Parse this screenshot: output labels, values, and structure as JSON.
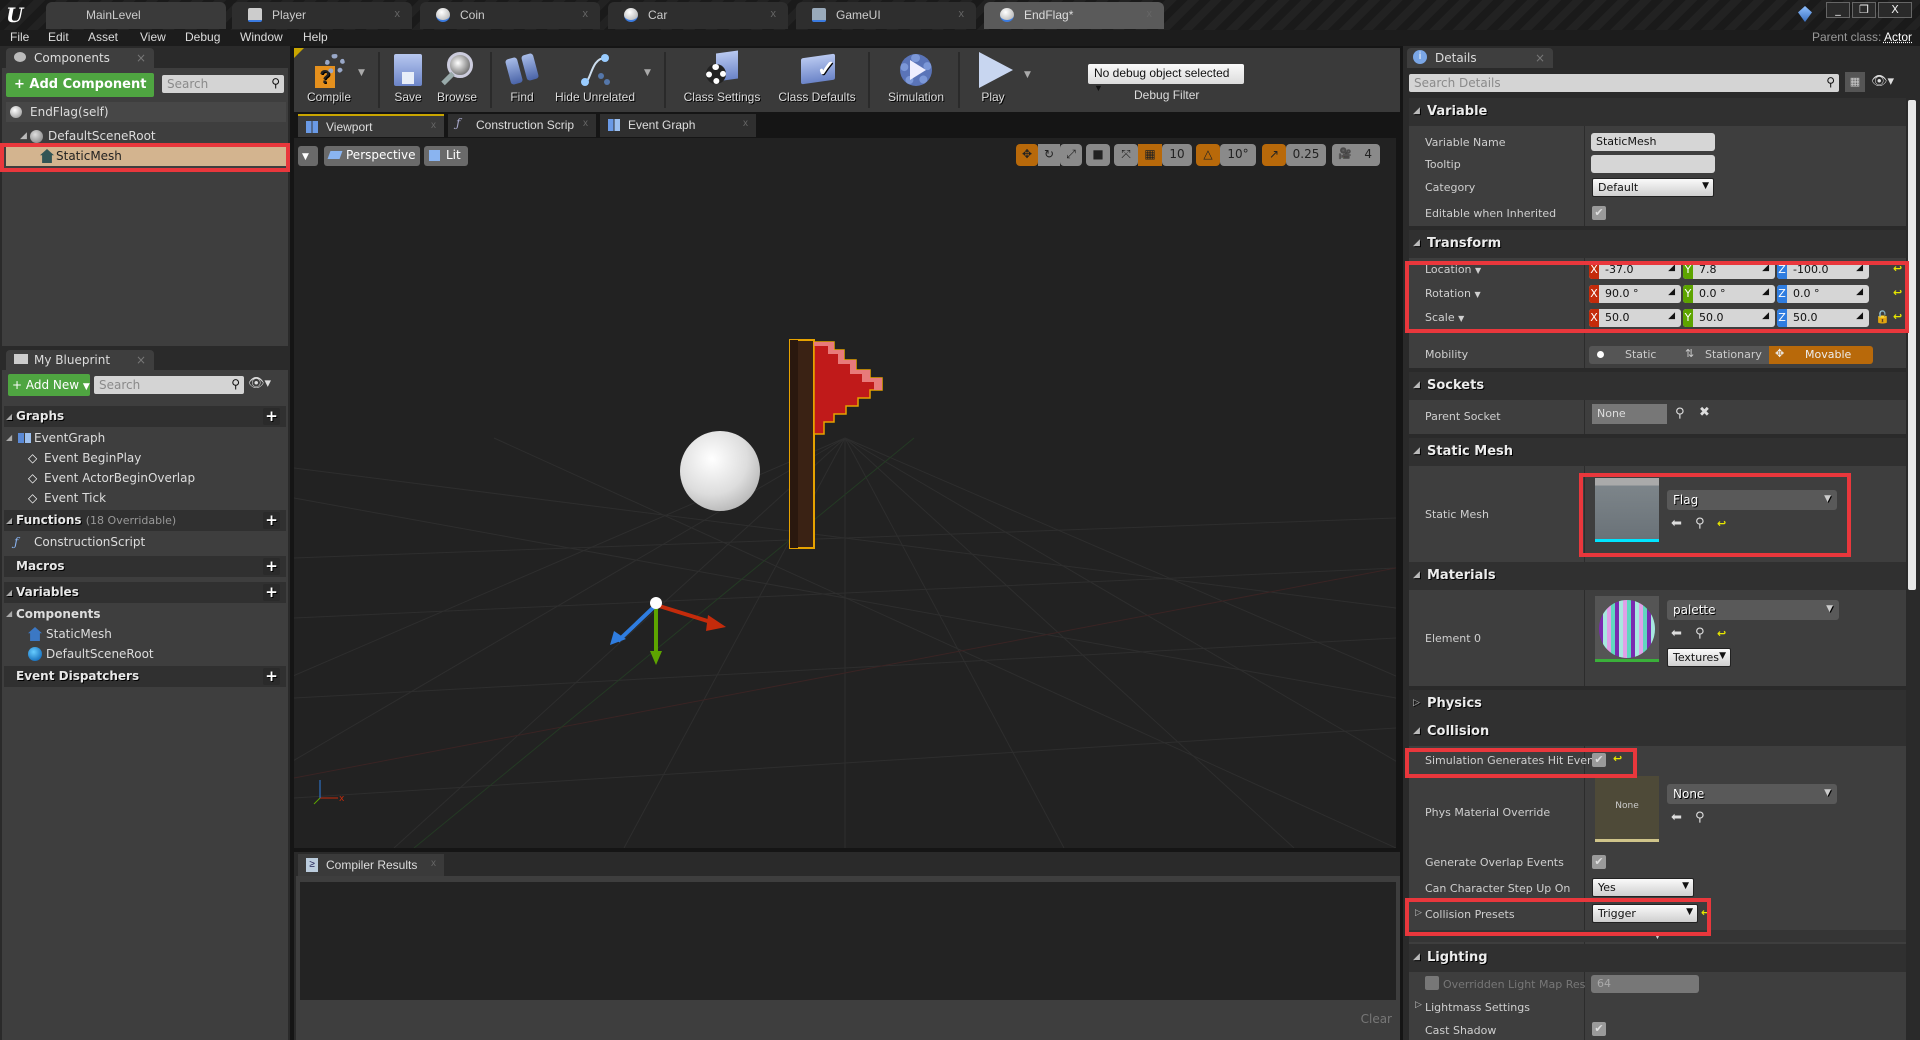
{
  "titlebar": {
    "tabs": [
      {
        "label": "MainLevel",
        "icon": "level-icon"
      },
      {
        "label": "Player",
        "icon": "character-blueprint-icon"
      },
      {
        "label": "Coin",
        "icon": "actor-blueprint-icon"
      },
      {
        "label": "Car",
        "icon": "actor-blueprint-icon"
      },
      {
        "label": "GameUI",
        "icon": "widget-blueprint-icon"
      },
      {
        "label": "EndFlag*",
        "icon": "actor-blueprint-icon",
        "active": true
      }
    ],
    "window_buttons": {
      "minimize": "_",
      "restore": "❐",
      "close": "X"
    }
  },
  "menubar": {
    "items": [
      "File",
      "Edit",
      "Asset",
      "View",
      "Debug",
      "Window",
      "Help"
    ],
    "parent_class_label": "Parent class:",
    "parent_class_value": "Actor"
  },
  "components": {
    "tab_label": "Components",
    "add_button": "+ Add Component",
    "search_placeholder": "Search",
    "self_item": "EndFlag(self)",
    "tree": [
      {
        "label": "DefaultSceneRoot",
        "icon": "scene-root-icon"
      },
      {
        "label": "StaticMesh",
        "icon": "static-mesh-icon",
        "selected": true
      }
    ]
  },
  "my_blueprint": {
    "tab_label": "My Blueprint",
    "add_button": "+ Add New",
    "search_placeholder": "Search",
    "graphs_label": "Graphs",
    "event_graph_label": "EventGraph",
    "events": [
      "Event BeginPlay",
      "Event ActorBeginOverlap",
      "Event Tick"
    ],
    "functions_label": "Functions",
    "functions_overridable": "(18 Overridable)",
    "functions": [
      "ConstructionScript"
    ],
    "macros_label": "Macros",
    "variables_label": "Variables",
    "components_label": "Components",
    "component_vars": [
      "StaticMesh",
      "DefaultSceneRoot"
    ],
    "event_dispatchers_label": "Event Dispatchers"
  },
  "toolbar": {
    "compile": "Compile",
    "save": "Save",
    "browse": "Browse",
    "find": "Find",
    "hide_unrelated": "Hide Unrelated",
    "class_settings": "Class Settings",
    "class_defaults": "Class Defaults",
    "simulation": "Simulation",
    "play": "Play",
    "debug_object": "No debug object selected",
    "debug_filter": "Debug Filter"
  },
  "editor_tabs": [
    {
      "label": "Viewport",
      "active": true
    },
    {
      "label": "Construction Scrip"
    },
    {
      "label": "Event Graph"
    }
  ],
  "viewport": {
    "view_mode": "Perspective",
    "lighting": "Lit",
    "grid_snap": "10",
    "rotation_snap": "10°",
    "scale_snap": "0.25",
    "camera_speed": "4"
  },
  "compiler": {
    "tab_label": "Compiler Results",
    "clear": "Clear"
  },
  "details": {
    "tab_label": "Details",
    "search_placeholder": "Search Details",
    "variable": {
      "section": "Variable",
      "name_label": "Variable Name",
      "name_value": "StaticMesh",
      "tooltip_label": "Tooltip",
      "tooltip_value": "",
      "category_label": "Category",
      "category_value": "Default",
      "editable_label": "Editable when Inherited",
      "editable_checked": true
    },
    "transform": {
      "section": "Transform",
      "location_label": "Location",
      "location": {
        "x": "-37.0",
        "y": "7.8",
        "z": "-100.0"
      },
      "rotation_label": "Rotation",
      "rotation": {
        "x": "90.0 °",
        "y": "0.0 °",
        "z": "0.0 °"
      },
      "scale_label": "Scale",
      "scale": {
        "x": "50.0",
        "y": "50.0",
        "z": "50.0"
      },
      "mobility_label": "Mobility",
      "mobility_options": [
        "Static",
        "Stationary",
        "Movable"
      ],
      "mobility_selected": "Movable"
    },
    "sockets": {
      "section": "Sockets",
      "parent_socket_label": "Parent Socket",
      "parent_socket_value": "None"
    },
    "static_mesh": {
      "section": "Static Mesh",
      "label": "Static Mesh",
      "value": "Flag"
    },
    "materials": {
      "section": "Materials",
      "element_label": "Element 0",
      "value": "palette",
      "textures_button": "Textures"
    },
    "physics": {
      "section": "Physics"
    },
    "collision": {
      "section": "Collision",
      "hit_event_label": "Simulation Generates Hit Event",
      "hit_event_checked": true,
      "phys_material_label": "Phys Material Override",
      "phys_material_thumb": "None",
      "phys_material_value": "None",
      "overlap_label": "Generate Overlap Events",
      "overlap_checked": true,
      "step_up_label": "Can Character Step Up On",
      "step_up_value": "Yes",
      "presets_label": "Collision Presets",
      "presets_value": "Trigger"
    },
    "lighting": {
      "section": "Lighting",
      "lightmap_res_label": "Overridden Light Map Res",
      "lightmap_res_value": "64",
      "lightmass_label": "Lightmass Settings",
      "cast_shadow_label": "Cast Shadow",
      "cast_shadow_checked": true
    }
  },
  "colors": {
    "accent_orange": "#b8690a",
    "highlight_red": "#e9373c",
    "add_green": "#4fa541",
    "axis_x": "#c42b0b",
    "axis_y": "#5da400",
    "axis_z": "#2f7de0"
  }
}
